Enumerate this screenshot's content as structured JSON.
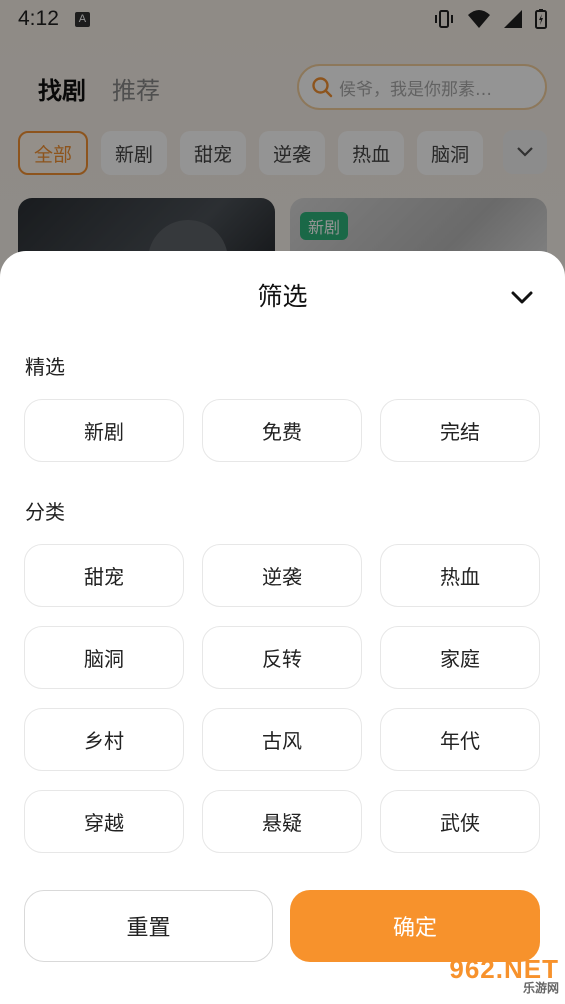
{
  "status_bar": {
    "time": "4:12",
    "notification_icon": "A"
  },
  "top_nav": {
    "tabs": [
      {
        "label": "找剧",
        "active": true
      },
      {
        "label": "推荐",
        "active": false
      }
    ],
    "search": {
      "value": "侯爷，我是你那素…"
    }
  },
  "category_chips": [
    "全部",
    "新剧",
    "甜宠",
    "逆袭",
    "热血",
    "脑洞"
  ],
  "active_chip": "全部",
  "cards": [
    {
      "tag": ""
    },
    {
      "tag": "新剧"
    }
  ],
  "filter_sheet": {
    "title": "筛选",
    "sections": [
      {
        "label": "精选",
        "options": [
          "新剧",
          "免费",
          "完结"
        ]
      },
      {
        "label": "分类",
        "options": [
          "甜宠",
          "逆袭",
          "热血",
          "脑洞",
          "反转",
          "家庭",
          "乡村",
          "古风",
          "年代",
          "穿越",
          "悬疑",
          "武侠"
        ]
      }
    ],
    "reset_label": "重置",
    "confirm_label": "确定"
  },
  "watermark": {
    "brand": "962.NET",
    "sub": "乐游网"
  },
  "colors": {
    "accent": "#f7922c",
    "chip_active": "#f39232",
    "tag_green": "#2db37a"
  }
}
